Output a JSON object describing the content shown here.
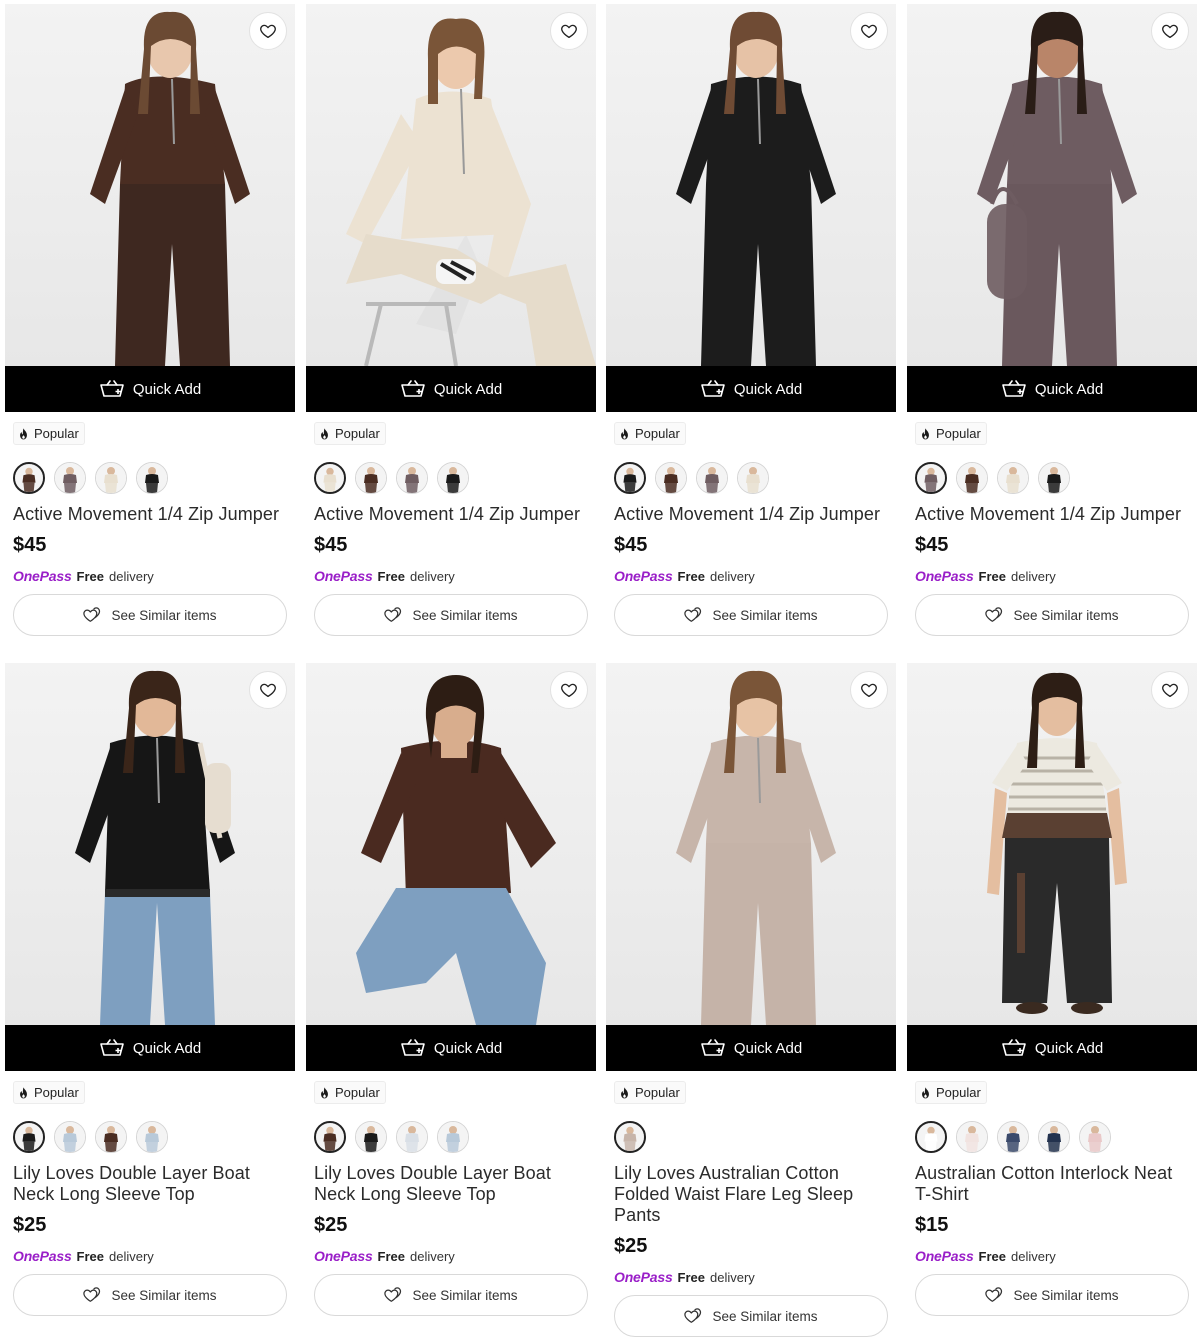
{
  "labels": {
    "quick_add": "Quick Add",
    "popular": "Popular",
    "onepass_logo": "OnePass",
    "free": "Free",
    "delivery": "delivery",
    "see_similar": "See Similar items"
  },
  "colors": {
    "onepass_purple": "#9a1fc8",
    "quick_add_bg": "#000000"
  },
  "products": [
    {
      "title": "Active Movement 1/4 Zip Jumper",
      "price": "$45",
      "garment_color": "#4a2d22",
      "pants_color": "#3e2820",
      "skin": "#e8c7ad",
      "hair": "#6b4a33",
      "pose": "standing-turn",
      "swatches": [
        "#4a2d22",
        "#6f5d61",
        "#e8dfcf",
        "#1a1a1a"
      ],
      "selected_swatch": 0
    },
    {
      "title": "Active Movement 1/4 Zip Jumper",
      "price": "$45",
      "garment_color": "#ece2d2",
      "pants_color": "#e6dccb",
      "skin": "#ecc9ad",
      "hair": "#7a5538",
      "pose": "seated",
      "swatches": [
        "#e8dfcf",
        "#4a2d22",
        "#6f5d61",
        "#1a1a1a"
      ],
      "selected_swatch": 0
    },
    {
      "title": "Active Movement 1/4 Zip Jumper",
      "price": "$45",
      "garment_color": "#1c1c1c",
      "pants_color": "#1c1c1c",
      "skin": "#e6c2a6",
      "hair": "#6f4b34",
      "pose": "standing",
      "swatches": [
        "#1a1a1a",
        "#4a2d22",
        "#6f5d61",
        "#e8dfcf"
      ],
      "selected_swatch": 0
    },
    {
      "title": "Active Movement 1/4 Zip Jumper",
      "price": "$45",
      "garment_color": "#6e5c61",
      "pants_color": "#6a585d",
      "skin": "#b98569",
      "hair": "#2a1d17",
      "pose": "standing-bag",
      "swatches": [
        "#6f5d61",
        "#4a2d22",
        "#e8dfcf",
        "#1a1a1a"
      ],
      "selected_swatch": 0
    },
    {
      "title": "Lily Loves Double Layer Boat Neck Long Sleeve Top",
      "price": "$25",
      "garment_color": "#161616",
      "pants_color": "#7e9fc0",
      "skin": "#e2b898",
      "hair": "#3a2519",
      "pose": "standing-hip",
      "swatches": [
        "#1a1a1a",
        "#b8c9d9",
        "#4a2d22",
        "#b8c9d9"
      ],
      "selected_swatch": 0
    },
    {
      "title": "Lily Loves Double Layer Boat Neck Long Sleeve Top",
      "price": "$25",
      "garment_color": "#4a2a20",
      "pants_color": "#7e9fc0",
      "skin": "#d8ad8d",
      "hair": "#2d1d14",
      "pose": "crouch",
      "swatches": [
        "#4a2d22",
        "#1a1a1a",
        "#d9dfe6",
        "#b8c9d9"
      ],
      "selected_swatch": 0
    },
    {
      "title": "Lily Loves Australian Cotton Folded Waist Flare Leg Sleep Pants",
      "price": "$25",
      "garment_color": "#c7b5aa",
      "pants_color": "#c5b3a8",
      "skin": "#e7c3a5",
      "hair": "#7a5538",
      "pose": "standing",
      "swatches": [
        "#c7b5aa"
      ],
      "selected_swatch": 0
    },
    {
      "title": "Australian Cotton Interlock Neat T-Shirt",
      "price": "$15",
      "garment_color": "#ece9e0",
      "pants_color": "#2a2a2a",
      "skin": "#e4bea0",
      "hair": "#2d1e15",
      "pose": "standing-tee",
      "swatches": [
        "#ffffff",
        "#f1e3e0",
        "#3b4a6b",
        "#23324e",
        "#e9c8c8"
      ],
      "selected_swatch": 0
    }
  ]
}
